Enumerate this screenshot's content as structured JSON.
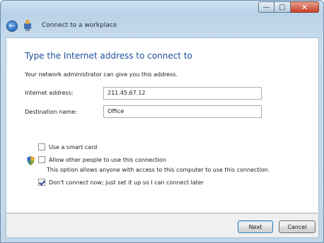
{
  "window": {
    "caption": {
      "minimize_icon": "minimize-icon",
      "maximize_icon": "maximize-icon",
      "close_icon": "close-icon"
    }
  },
  "nav": {
    "back_icon": "back-arrow-icon",
    "wizard_icon": "network-connection-icon",
    "title": "Connect to a workplace"
  },
  "page": {
    "heading": "Type the Internet address to connect to",
    "description": "Your network administrator can give you this address."
  },
  "form": {
    "internet_address": {
      "label": "Internet address:",
      "value": "211.45.67.12"
    },
    "destination_name": {
      "label": "Destination name:",
      "value": "Office"
    }
  },
  "options": {
    "smart_card": {
      "label": "Use a smart card",
      "checked": false
    },
    "allow_others": {
      "label": "Allow other people to use this connection",
      "checked": false,
      "shield_icon": "uac-shield-icon",
      "note": "This option allows anyone with access to this computer to use this connection."
    },
    "dont_connect": {
      "label": "Don't connect now; just set it up so I can connect later",
      "checked": true
    }
  },
  "buttons": {
    "next": "Next",
    "cancel": "Cancel"
  }
}
